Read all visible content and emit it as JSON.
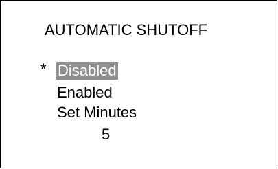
{
  "screen": {
    "title": "AUTOMATIC SHUTOFF",
    "cursor": "*",
    "options": [
      {
        "label": "Disabled",
        "selected": true
      },
      {
        "label": "Enabled",
        "selected": false
      },
      {
        "label": "Set Minutes",
        "selected": false
      }
    ],
    "minutes_value": "5",
    "colors": {
      "selection_background": "#8f8f8f",
      "selection_text": "#ffffff",
      "text": "#000000",
      "background": "#ffffff",
      "border": "#000000"
    }
  }
}
